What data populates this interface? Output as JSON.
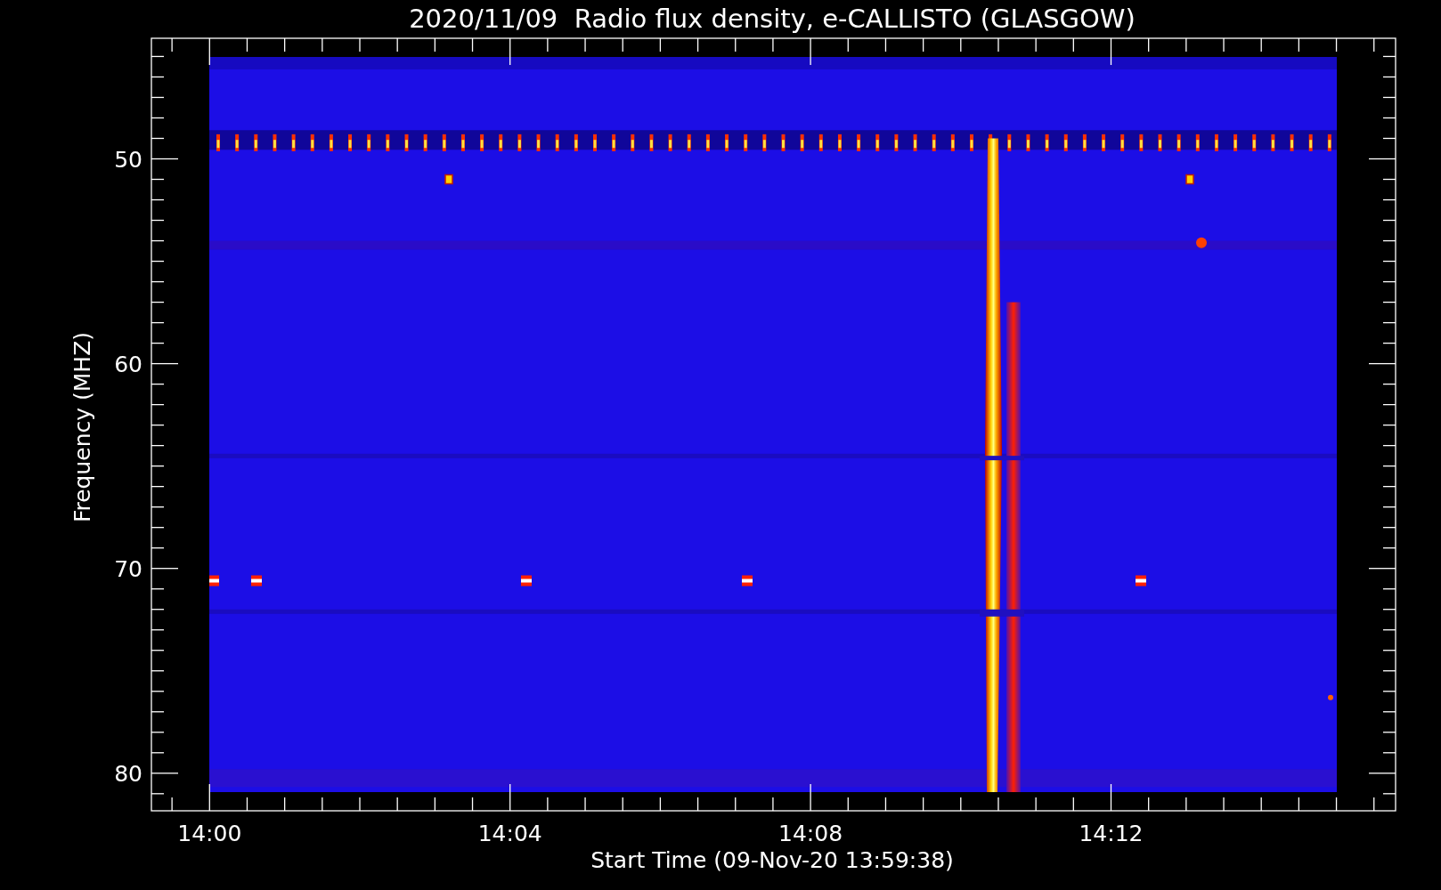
{
  "title": "2020/11/09  Radio flux density, e-CALLISTO (GLASGOW)",
  "x_axis": {
    "label": "Start Time (09-Nov-20 13:59:38)",
    "ticks": [
      "14:00",
      "14:04",
      "14:08",
      "14:12"
    ]
  },
  "y_axis": {
    "label": "Frequency (MHZ)",
    "ticks": [
      "50",
      "60",
      "70",
      "80"
    ]
  }
}
